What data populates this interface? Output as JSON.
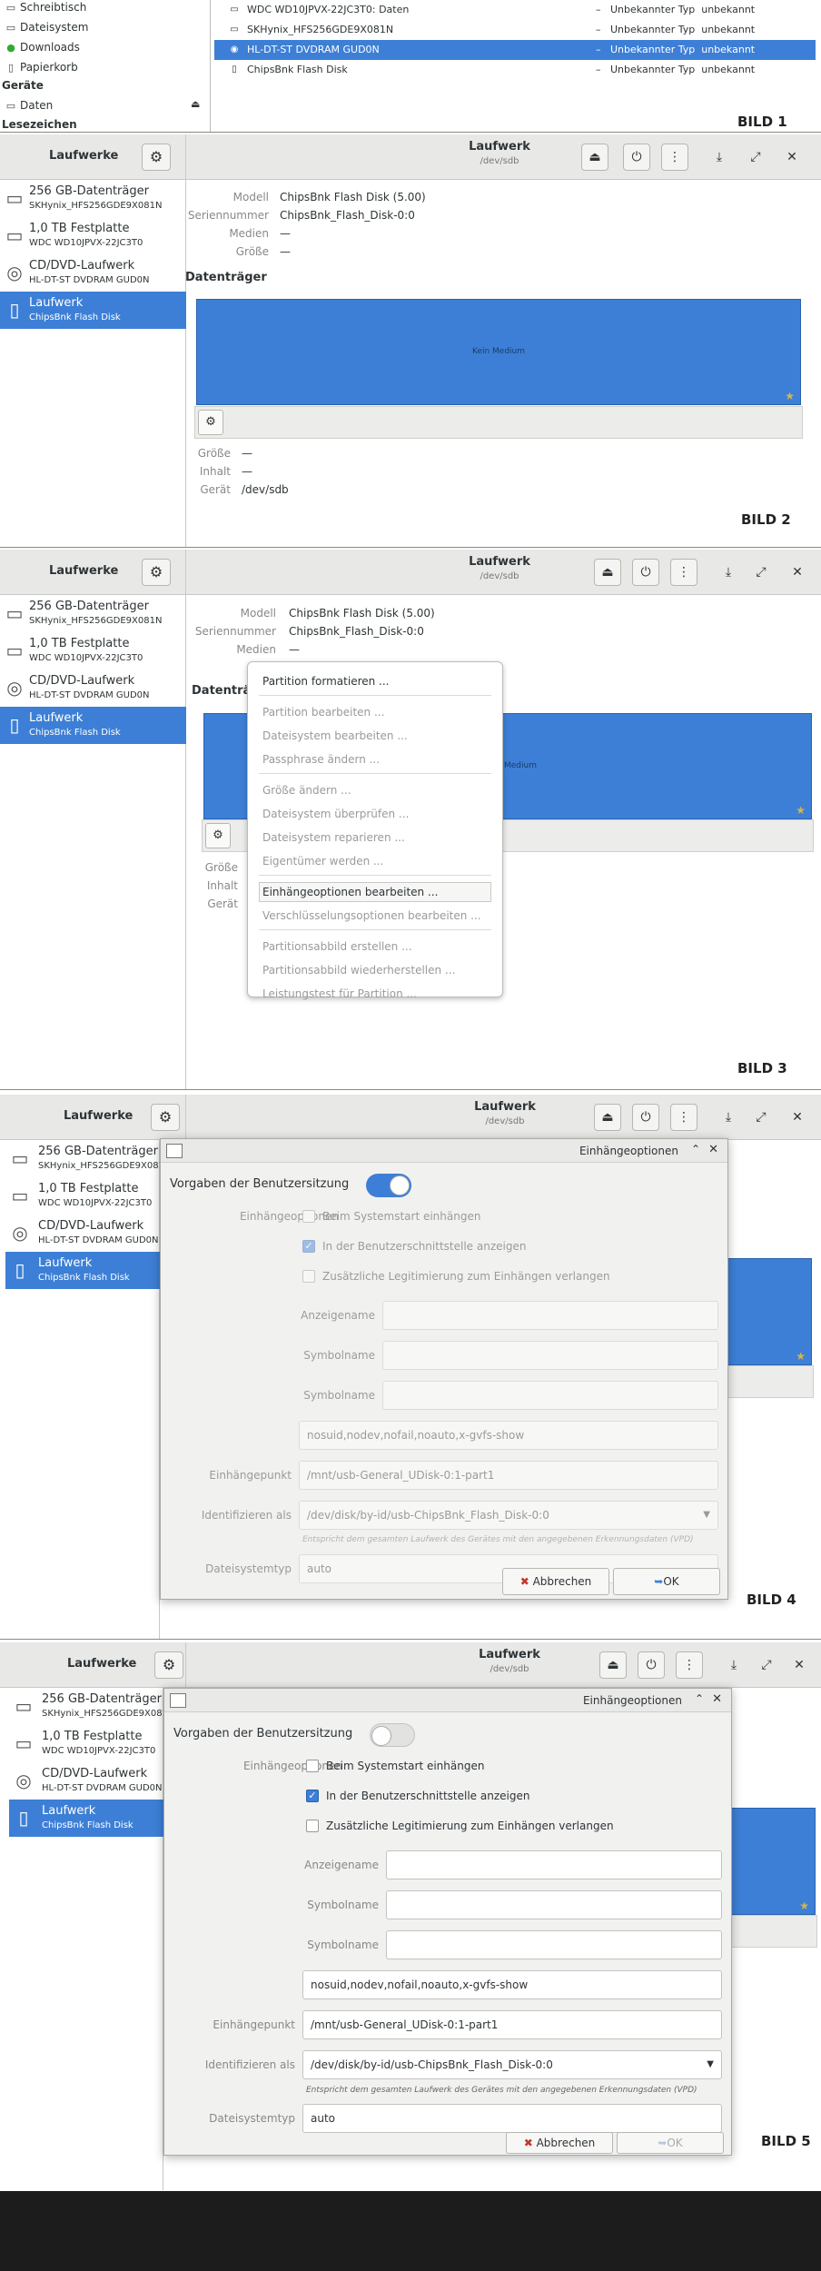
{
  "shot1": {
    "caption": "BILD 1",
    "places": [
      "Schreibtisch",
      "Dateisystem",
      "Downloads",
      "Papierkorb"
    ],
    "devices_header": "Geräte",
    "device_item": "Daten",
    "bookmarks_header": "Lesezeichen",
    "files": [
      {
        "name": "WDC WD10JPVX-22JC3T0: Daten",
        "dash": "–",
        "type": "Unbekannter Typ",
        "status": "unbekannt"
      },
      {
        "name": "SKHynix_HFS256GDE9X081N",
        "dash": "–",
        "type": "Unbekannter Typ",
        "status": "unbekannt"
      },
      {
        "name": "HL-DT-ST DVDRAM GUD0N",
        "dash": "–",
        "type": "Unbekannter Typ",
        "status": "unbekannt"
      },
      {
        "name": "ChipsBnk Flash Disk",
        "dash": "–",
        "type": "Unbekannter Typ",
        "status": "unbekannt"
      }
    ]
  },
  "app": {
    "sidebar_title": "Laufwerke",
    "title": "Laufwerk",
    "subtitle": "/dev/sdb",
    "drives": [
      {
        "name": "256 GB-Datenträger",
        "detail": "SKHynix_HFS256GDE9X081N"
      },
      {
        "name": "1,0 TB Festplatte",
        "detail": "WDC WD10JPVX-22JC3T0"
      },
      {
        "name": "CD/DVD-Laufwerk",
        "detail": "HL-DT-ST DVDRAM GUD0N"
      },
      {
        "name": "Laufwerk",
        "detail": "ChipsBnk Flash Disk"
      }
    ]
  },
  "shot2": {
    "caption": "BILD 2",
    "model_label": "Modell",
    "model_value": "ChipsBnk Flash Disk (5.00)",
    "serial_label": "Seriennummer",
    "serial_value": "ChipsBnk_Flash_Disk-0:0",
    "media_label": "Medien",
    "media_value": "—",
    "size_label": "Größe",
    "size_value": "—",
    "volumes_header": "Datenträger",
    "volume_text": "Kein Medium",
    "vsize_label": "Größe",
    "vsize_value": "—",
    "content_label": "Inhalt",
    "content_value": "—",
    "device_label": "Gerät",
    "device_value": "/dev/sdb"
  },
  "shot3": {
    "caption": "BILD 3",
    "model_label": "Modell",
    "model_value": "ChipsBnk Flash Disk (5.00)",
    "serial_label": "Seriennummer",
    "serial_value": "ChipsBnk_Flash_Disk-0:0",
    "media_label": "Medien",
    "media_value": "—",
    "size_label": "G",
    "volumes_header": "Datenträ",
    "volume_text": "Medium",
    "vsize_label": "Größe",
    "content_label": "Inhalt",
    "device_label": "Gerät",
    "menu_items": [
      "Partition formatieren ...",
      "Partition bearbeiten ...",
      "Dateisystem bearbeiten ...",
      "Passphrase ändern ...",
      "Größe ändern ...",
      "Dateisystem überprüfen ...",
      "Dateisystem reparieren ...",
      "Eigentümer werden ...",
      "Einhängeoptionen bearbeiten ...",
      "Verschlüsselungsoptionen bearbeiten ...",
      "Partitionsabbild erstellen ...",
      "Partitionsabbild wiederherstellen ...",
      "Leistungstest für Partition ..."
    ]
  },
  "dialog": {
    "title": "Einhängeoptionen",
    "session_defaults": "Vorgaben der Benutzersitzung",
    "mount_options_label": "Einhängeoptionen",
    "cb_startup": "Beim Systemstart einhängen",
    "cb_show_ui": "In der Benutzerschnittstelle anzeigen",
    "cb_auth": "Zusätzliche Legitimierung zum Einhängen verlangen",
    "display_name_label": "Anzeigename",
    "icon_name_label": "Symbolname",
    "symbolic_icon_label": "Symbolname",
    "options_value": "nosuid,nodev,nofail,noauto,x-gvfs-show",
    "mount_point_label": "Einhängepunkt",
    "mount_point_value": "/mnt/usb-General_UDisk-0:1-part1",
    "identify_label": "Identifizieren als",
    "identify_value": "/dev/disk/by-id/usb-ChipsBnk_Flash_Disk-0:0",
    "identify_hint": "Entspricht dem gesamten Laufwerk des Gerätes mit den angegebenen Erkennungsdaten (VPD)",
    "fstype_label": "Dateisystemtyp",
    "fstype_value": "auto",
    "cancel": "Abbrechen",
    "ok": "OK"
  },
  "shot4": {
    "caption": "BILD 4",
    "session_defaults_on": true
  },
  "shot5": {
    "caption": "BILD 5",
    "session_defaults_on": false
  },
  "colors": {
    "accent": "#3d7fd6",
    "headerbar": "#e8e8e7",
    "bottom_band": "#1c1c1c"
  }
}
